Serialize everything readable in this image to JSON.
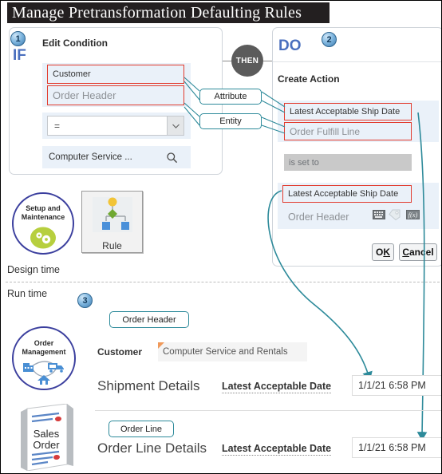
{
  "page": {
    "title": "Manage Pretransformation Defaulting Rules"
  },
  "design": {
    "if_panel": {
      "badge": "1",
      "keyword": "IF",
      "heading": "Edit Condition",
      "attribute_value": "Customer",
      "entity_value": "Order Header",
      "operator_value": "=",
      "lookup_value": "Computer Service ...",
      "search_icon": "magnifier-icon",
      "dropdown_icon": "chevron-down-icon"
    },
    "connector": {
      "label": "THEN"
    },
    "callouts": [
      {
        "label": "Attribute"
      },
      {
        "label": "Entity"
      }
    ],
    "do_panel": {
      "badge": "2",
      "keyword": "DO",
      "heading": "Create Action",
      "action_attribute": "Latest Acceptable Ship Date",
      "action_entity": "Order Fulfill Line",
      "operator_text": "is set to",
      "value_attribute": "Latest Acceptable Ship Date",
      "value_entity": "Order Header",
      "value_icons": [
        "keyboard-icon",
        "tag-icon",
        "function-fx-icon"
      ],
      "buttons": [
        {
          "name": "ok-button",
          "pre": "O",
          "mnemonic": "K",
          "post": ""
        },
        {
          "name": "cancel-button",
          "pre": "",
          "mnemonic": "C",
          "post": "ancel"
        }
      ]
    },
    "setup_icon": {
      "line1": "Setup and",
      "line2": "Maintenance",
      "glyph": "gears-icon"
    },
    "rule_icon": {
      "label": "Rule",
      "glyph": "rule-flow-icon"
    },
    "phase_label": "Design time"
  },
  "runtime": {
    "phase_label": "Run time",
    "badge": "3",
    "om_icon": {
      "line1": "Order",
      "line2": "Management",
      "glyph": "supply-chain-icon"
    },
    "so_icon": {
      "line1": "Sales",
      "line2": "Order",
      "glyph": "sales-order-doc-icon"
    },
    "header_tag": "Order Header",
    "line_tag": "Order Line",
    "customer_label": "Customer",
    "customer_value": "Computer Service and Rentals",
    "shipment": {
      "section_label": "Shipment Details",
      "field_label": "Latest Acceptable Date",
      "field_value": "1/1/21 6:58 PM"
    },
    "order_line": {
      "section_label": "Order Line Details",
      "field_label": "Latest Acceptable Date",
      "field_value": "1/1/21 6:58 PM"
    }
  },
  "colors": {
    "banner_bg": "#231f20",
    "highlight_red": "#e23b2e",
    "callout_teal": "#2d8a9a",
    "keyword_blue": "#4a6fbe",
    "field_blue": "#eaf1f9",
    "required_orange": "#f0995a"
  }
}
